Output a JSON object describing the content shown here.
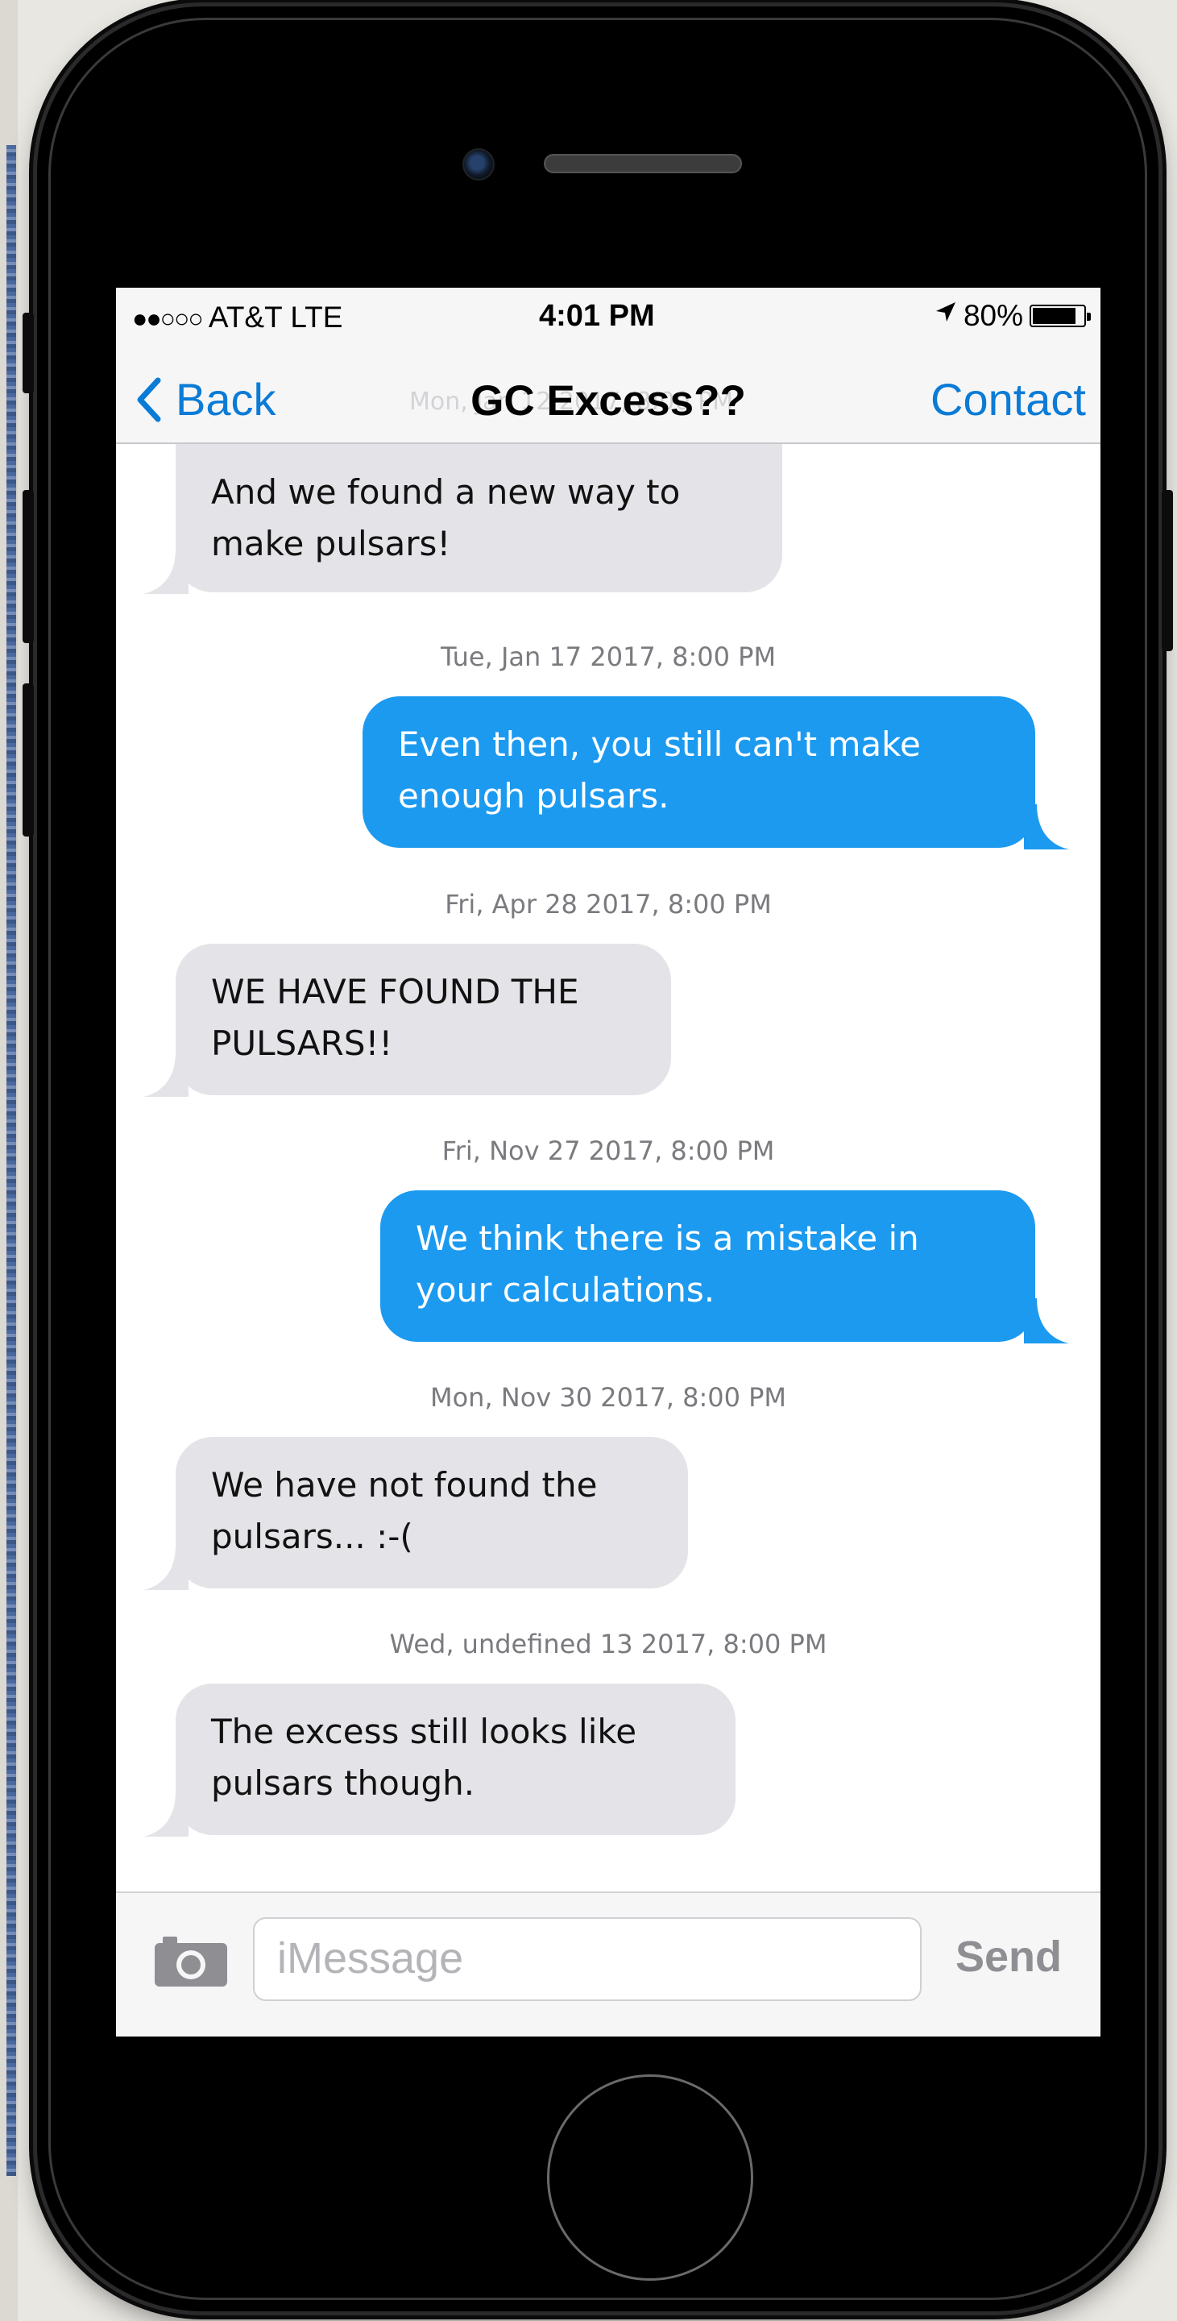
{
  "statusbar": {
    "signal_dots": "●●○○○",
    "carrier": "AT&T LTE",
    "time": "4:01 PM",
    "location_arrow": "➚",
    "battery": "80%"
  },
  "navbar": {
    "back_label": "Back",
    "title": "GC Excess??",
    "ghost_timestamp": "Mon, Jan 12 2017, 8:00 PM",
    "contact_label": "Contact"
  },
  "messages": [
    {
      "type": "received",
      "text_line1": "And we found a new way to",
      "text_line2": "make pulsars!"
    },
    {
      "type": "timestamp",
      "text": "Tue, Jan 17 2017, 8:00 PM"
    },
    {
      "type": "sent",
      "text_line1": "Even then, you still can't make",
      "text_line2": "enough pulsars."
    },
    {
      "type": "timestamp",
      "text": "Fri, Apr 28 2017, 8:00 PM"
    },
    {
      "type": "received",
      "text_line1": "WE HAVE FOUND THE",
      "text_line2": "PULSARS!!"
    },
    {
      "type": "timestamp",
      "text": "Fri, Nov 27 2017, 8:00 PM"
    },
    {
      "type": "sent",
      "text_line1": "We think there is a mistake in",
      "text_line2": "your calculations."
    },
    {
      "type": "timestamp",
      "text": "Mon, Nov 30 2017, 8:00 PM"
    },
    {
      "type": "received",
      "text_line1": "We have not found the",
      "text_line2": "pulsars... :-("
    },
    {
      "type": "timestamp",
      "text": "Wed, undefined 13 2017, 8:00 PM"
    },
    {
      "type": "received",
      "text_line1": "The excess still looks like",
      "text_line2": "pulsars though."
    }
  ],
  "inputbar": {
    "camera_icon": "camera-icon",
    "placeholder": "iMessage",
    "send_label": "Send"
  },
  "colors": {
    "sent_bubble": "#1c9af0",
    "received_bubble": "#e4e4e8",
    "link": "#0a7bd6"
  }
}
